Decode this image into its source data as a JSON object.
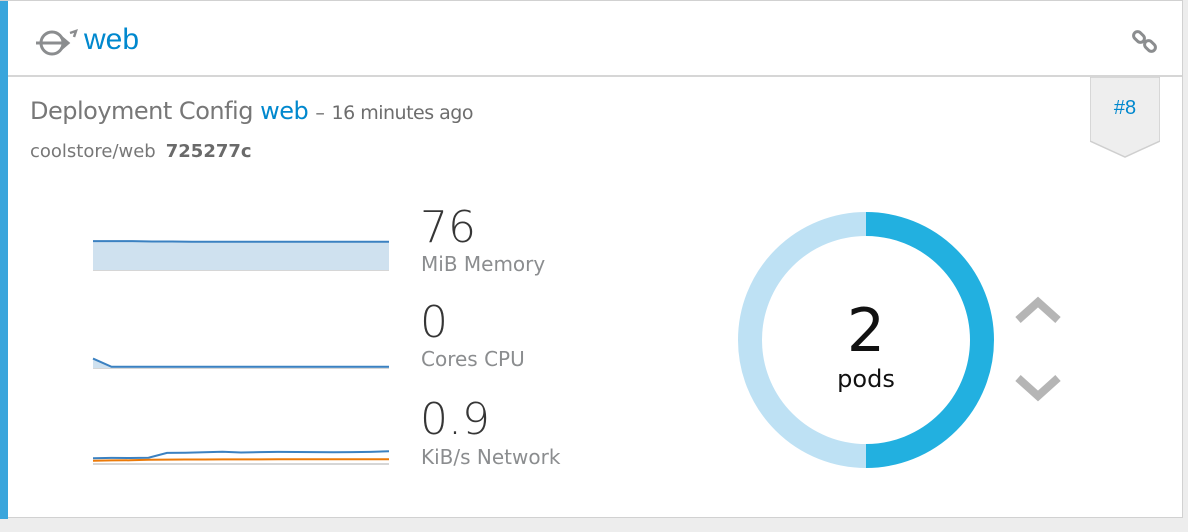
{
  "service": {
    "title": "web",
    "icon": "service-route-icon",
    "link_icon": "link-icon"
  },
  "deployment": {
    "prefix": "Deployment Config",
    "name": "web",
    "separator": "–",
    "age": "16 minutes ago",
    "image_repo": "coolstore/web",
    "commit": "725277c",
    "revision_badge": "#8"
  },
  "metrics": [
    {
      "value": "76",
      "label": "MiB Memory",
      "chart_data": {
        "type": "area",
        "series": [
          {
            "values": [
              82,
              82,
              82,
              81,
              81,
              80,
              80,
              80,
              80,
              80,
              80,
              80,
              80,
              80,
              80,
              80
            ]
          }
        ],
        "ylim": [
          0,
          100
        ]
      }
    },
    {
      "value": "0",
      "label": "Cores CPU",
      "chart_data": {
        "type": "area",
        "series": [
          {
            "values": [
              0.9,
              0.02,
              0.02,
              0.02,
              0.02,
              0.02,
              0.02,
              0.02,
              0.02,
              0.02,
              0.02,
              0.02,
              0.02,
              0.02,
              0.02,
              0.03,
              0.02
            ]
          }
        ],
        "ylim": [
          0,
          3
        ]
      }
    },
    {
      "value": "0.9",
      "label": "KiB/s Network",
      "chart_data": {
        "type": "line",
        "series": [
          {
            "values": [
              0.45,
              0.48,
              0.47,
              0.5,
              0.95,
              0.97,
              1.0,
              1.05,
              0.98,
              1.02,
              1.04,
              1.03,
              1.02,
              1.0,
              1.02,
              1.04,
              1.1
            ]
          },
          {
            "values": [
              0.22,
              0.24,
              0.25,
              0.3,
              0.32,
              0.33,
              0.33,
              0.34,
              0.34,
              0.34,
              0.35,
              0.35,
              0.35,
              0.35,
              0.35,
              0.35,
              0.35
            ]
          }
        ],
        "ylim": [
          0,
          3
        ]
      }
    }
  ],
  "pods": {
    "count": "2",
    "label": "pods",
    "chart_data": {
      "type": "pie",
      "values": [
        1,
        1
      ],
      "colors": [
        "#bee1f4",
        "#22b0e0"
      ]
    }
  },
  "scale": {
    "up_icon": "chevron-up-icon",
    "down_icon": "chevron-down-icon"
  },
  "colors": {
    "accent": "#39a5dc",
    "link": "#0088ce",
    "spark_line": "#3b81c1",
    "spark_fill": "#cfe1ef",
    "network_secondary": "#ec7a08",
    "donut_ready": "#22b0e0",
    "donut_pending": "#bee1f4"
  }
}
